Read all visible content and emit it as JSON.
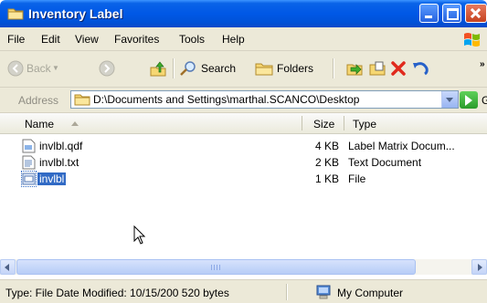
{
  "window": {
    "title": "Inventory Label"
  },
  "menu": [
    "File",
    "Edit",
    "View",
    "Favorites",
    "Tools",
    "Help"
  ],
  "toolbar": {
    "back_label": "Back",
    "search_label": "Search",
    "folders_label": "Folders"
  },
  "address": {
    "label": "Address",
    "value": "D:\\Documents and Settings\\marthal.SCANCO\\Desktop",
    "go_label": "Go"
  },
  "columns": {
    "name": "Name",
    "size": "Size",
    "type": "Type"
  },
  "files": [
    {
      "name": "invlbl.qdf",
      "size": "4 KB",
      "type": "Label Matrix Docum...",
      "icon": "label-matrix-doc-icon",
      "selected": false
    },
    {
      "name": "invlbl.txt",
      "size": "2 KB",
      "type": "Text Document",
      "icon": "text-document-icon",
      "selected": false
    },
    {
      "name": "invlbl",
      "size": "1 KB",
      "type": "File",
      "icon": "generic-file-icon",
      "selected": true
    }
  ],
  "status": {
    "details": "Type: File Date Modified: 10/15/200 520 bytes",
    "location": "My Computer"
  },
  "colors": {
    "titlebar": "#0058e6",
    "selection": "#316ac5",
    "chrome": "#ece9d8"
  }
}
